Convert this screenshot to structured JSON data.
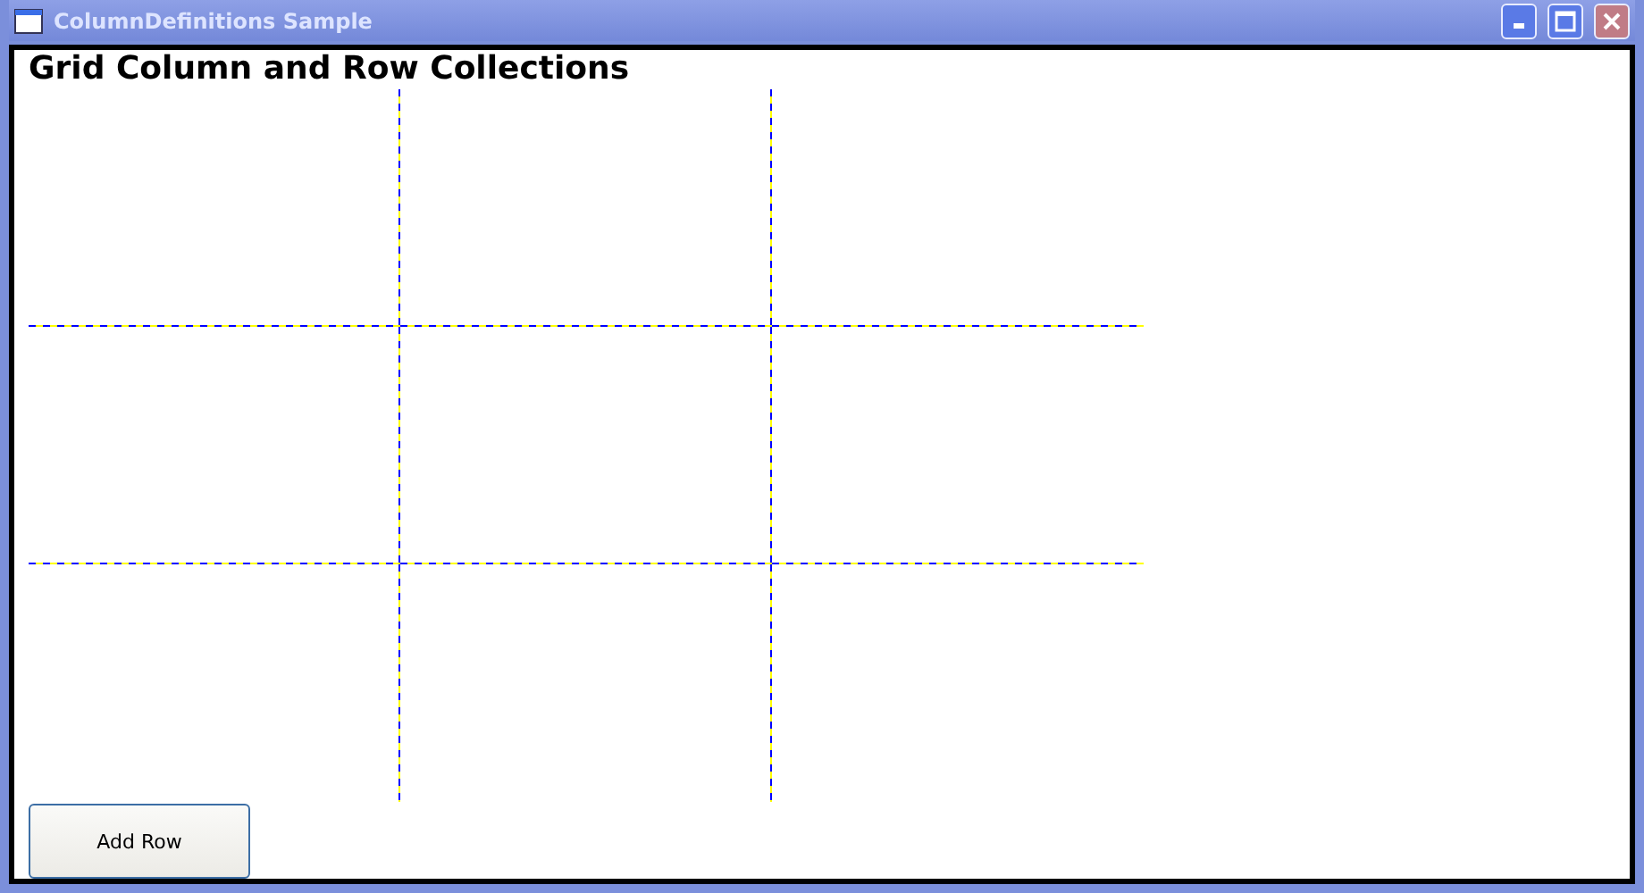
{
  "window": {
    "title": "ColumnDefinitions Sample"
  },
  "heading": "Grid Column and Row Collections",
  "buttons": [
    "Add Row"
  ]
}
